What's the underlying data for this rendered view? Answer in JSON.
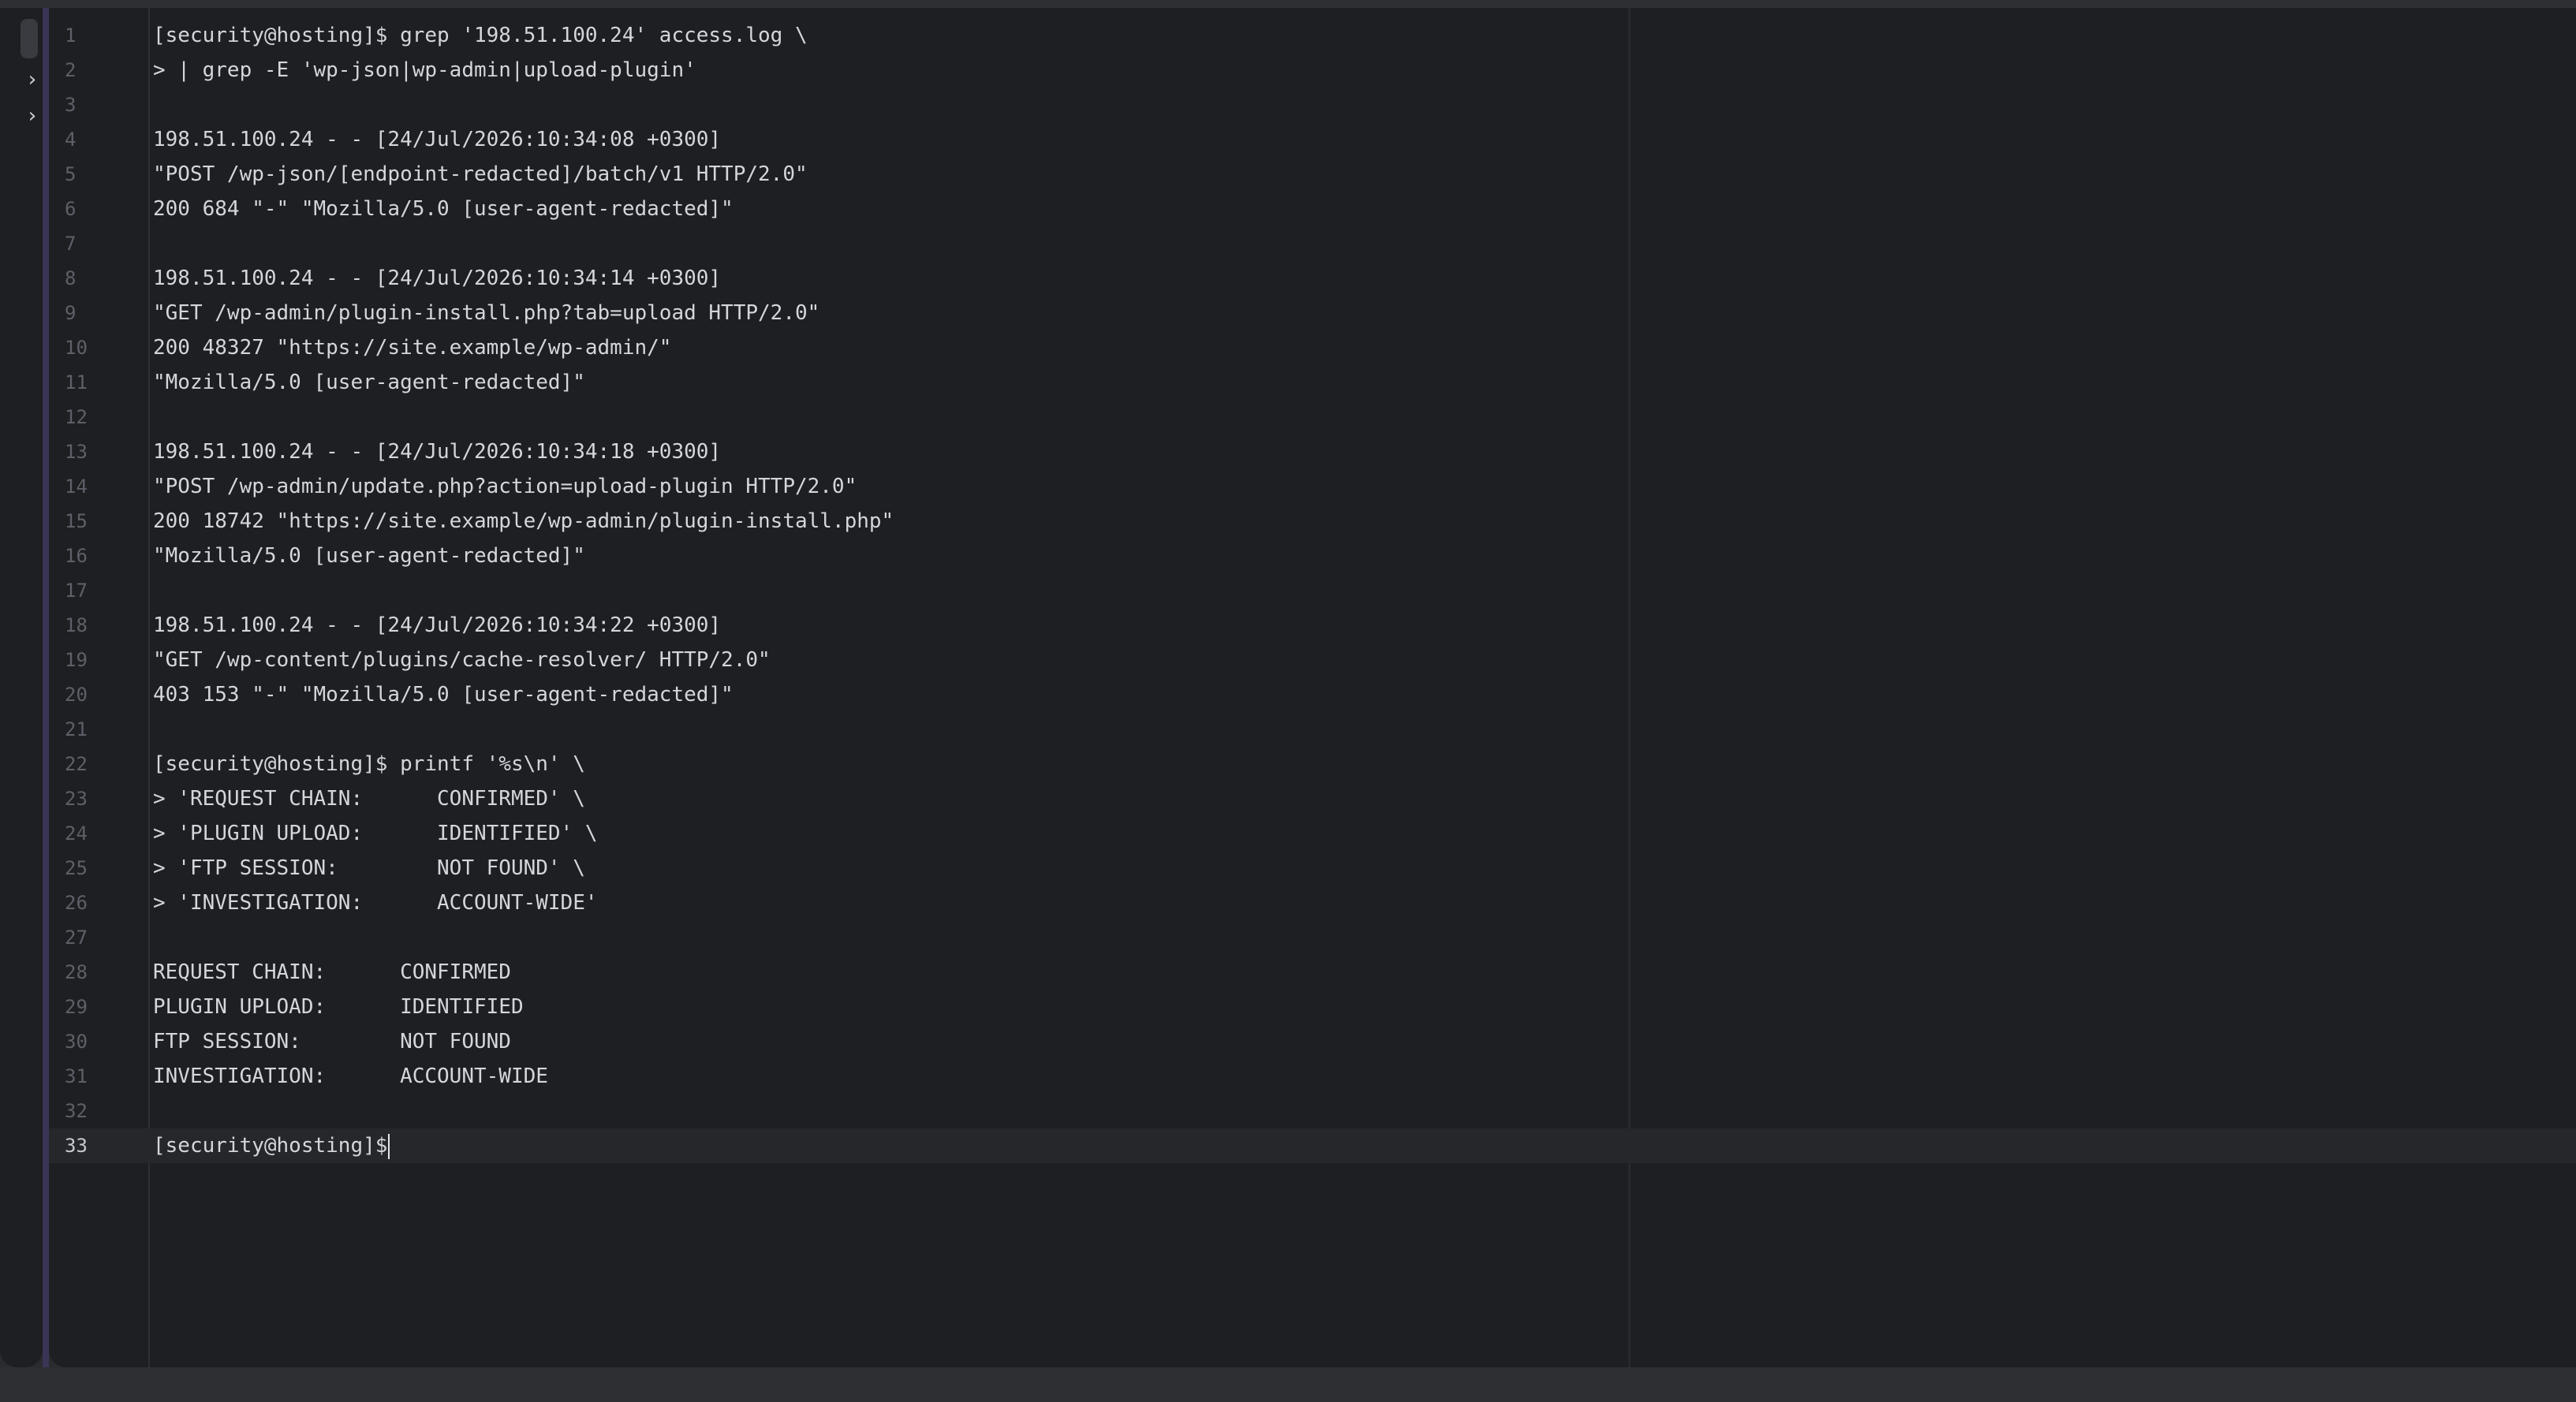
{
  "editor": {
    "lines": [
      {
        "n": "1",
        "text": "[security@hosting]$ grep '198.51.100.24' access.log \\"
      },
      {
        "n": "2",
        "text": "> | grep -E 'wp-json|wp-admin|upload-plugin'"
      },
      {
        "n": "3",
        "text": ""
      },
      {
        "n": "4",
        "text": "198.51.100.24 - - [24/Jul/2026:10:34:08 +0300]"
      },
      {
        "n": "5",
        "text": "\"POST /wp-json/[endpoint-redacted]/batch/v1 HTTP/2.0\""
      },
      {
        "n": "6",
        "text": "200 684 \"-\" \"Mozilla/5.0 [user-agent-redacted]\""
      },
      {
        "n": "7",
        "text": ""
      },
      {
        "n": "8",
        "text": "198.51.100.24 - - [24/Jul/2026:10:34:14 +0300]"
      },
      {
        "n": "9",
        "text": "\"GET /wp-admin/plugin-install.php?tab=upload HTTP/2.0\""
      },
      {
        "n": "10",
        "text": "200 48327 \"https://site.example/wp-admin/\""
      },
      {
        "n": "11",
        "text": "\"Mozilla/5.0 [user-agent-redacted]\""
      },
      {
        "n": "12",
        "text": ""
      },
      {
        "n": "13",
        "text": "198.51.100.24 - - [24/Jul/2026:10:34:18 +0300]"
      },
      {
        "n": "14",
        "text": "\"POST /wp-admin/update.php?action=upload-plugin HTTP/2.0\""
      },
      {
        "n": "15",
        "text": "200 18742 \"https://site.example/wp-admin/plugin-install.php\""
      },
      {
        "n": "16",
        "text": "\"Mozilla/5.0 [user-agent-redacted]\""
      },
      {
        "n": "17",
        "text": ""
      },
      {
        "n": "18",
        "text": "198.51.100.24 - - [24/Jul/2026:10:34:22 +0300]"
      },
      {
        "n": "19",
        "text": "\"GET /wp-content/plugins/cache-resolver/ HTTP/2.0\""
      },
      {
        "n": "20",
        "text": "403 153 \"-\" \"Mozilla/5.0 [user-agent-redacted]\""
      },
      {
        "n": "21",
        "text": ""
      },
      {
        "n": "22",
        "text": "[security@hosting]$ printf '%s\\n' \\"
      },
      {
        "n": "23",
        "text": "> 'REQUEST CHAIN:      CONFIRMED' \\"
      },
      {
        "n": "24",
        "text": "> 'PLUGIN UPLOAD:      IDENTIFIED' \\"
      },
      {
        "n": "25",
        "text": "> 'FTP SESSION:        NOT FOUND' \\"
      },
      {
        "n": "26",
        "text": "> 'INVESTIGATION:      ACCOUNT-WIDE'"
      },
      {
        "n": "27",
        "text": ""
      },
      {
        "n": "28",
        "text": "REQUEST CHAIN:      CONFIRMED"
      },
      {
        "n": "29",
        "text": "PLUGIN UPLOAD:      IDENTIFIED"
      },
      {
        "n": "30",
        "text": "FTP SESSION:        NOT FOUND"
      },
      {
        "n": "31",
        "text": "INVESTIGATION:      ACCOUNT-WIDE"
      },
      {
        "n": "32",
        "text": ""
      },
      {
        "n": "33",
        "text": "[security@hosting]$"
      }
    ],
    "active_line": "33"
  },
  "sidebar": {
    "chevrons": [
      {
        "icon": "chevron-right-icon",
        "glyph": "›"
      },
      {
        "icon": "chevron-right-icon",
        "glyph": "›"
      }
    ]
  }
}
